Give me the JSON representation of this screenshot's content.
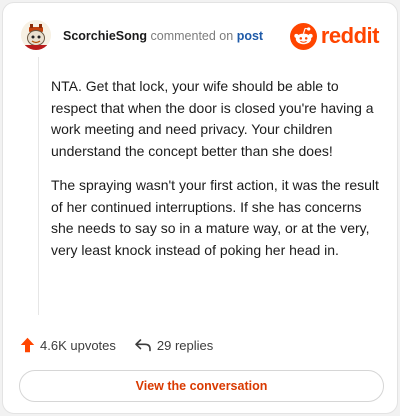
{
  "comment": {
    "author": "ScorchieSong",
    "action": "commented on",
    "target": "post",
    "paragraphs": [
      "NTA. Get that lock, your wife should be able to respect that when the door is closed you're having a work meeting and need privacy. Your children understand the concept better than she does!",
      "The spraying wasn't your first action, it was the result of her continued interruptions. If she has concerns she needs to say so in a mature way, or at the very, very least knock instead of poking her head in."
    ]
  },
  "brand": {
    "name": "reddit",
    "icon": "reddit-logo-icon",
    "color": "#ff4500"
  },
  "stats": {
    "upvotes": "4.6K upvotes",
    "upvote_icon": "upvote-arrow-icon",
    "replies": "29 replies",
    "reply_icon": "reply-arrow-icon"
  },
  "actions": {
    "view_conversation": "View the conversation"
  },
  "colors": {
    "accent": "#ff4500",
    "link": "#1e5aa8",
    "button_text": "#d93900"
  }
}
